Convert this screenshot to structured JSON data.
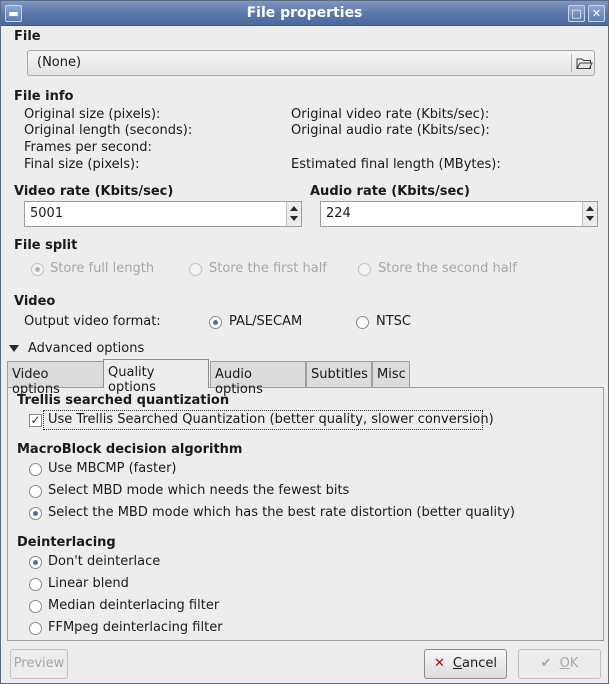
{
  "window": {
    "title": "File properties"
  },
  "file": {
    "section": "File",
    "selected": "(None)",
    "browse_icon": "folder-open-icon"
  },
  "file_info": {
    "section": "File info",
    "original_size": "Original size (pixels):",
    "original_length": "Original length (seconds):",
    "frames_per_second": "Frames per second:",
    "final_size": "Final size (pixels):",
    "original_video_rate": "Original video rate (Kbits/sec):",
    "original_audio_rate": "Original audio rate (Kbits/sec):",
    "estimated_final_length": "Estimated final length (MBytes):"
  },
  "video_rate": {
    "label": "Video rate (Kbits/sec)",
    "value": "5001"
  },
  "audio_rate": {
    "label": "Audio rate (Kbits/sec)",
    "value": "224"
  },
  "file_split": {
    "section": "File split",
    "options": [
      "Store full length",
      "Store the first half",
      "Store the second half"
    ],
    "selected": 0,
    "enabled": false
  },
  "video": {
    "section": "Video",
    "format_label": "Output video format:",
    "options": [
      "PAL/SECAM",
      "NTSC"
    ],
    "selected": 0
  },
  "advanced": {
    "label": "Advanced options",
    "expanded": true
  },
  "tabs": {
    "items": [
      "Video options",
      "Quality options",
      "Audio options",
      "Subtitles",
      "Misc"
    ],
    "active": 1
  },
  "quality": {
    "trellis_title": "Trellis searched quantization",
    "trellis_check": "Use Trellis Searched Quantization (better quality, slower conversion)",
    "trellis_checked": true,
    "macroblock_title": "MacroBlock decision algorithm",
    "macroblock_options": [
      "Use MBCMP (faster)",
      "Select MBD mode which needs the fewest bits",
      "Select the MBD mode which has the best rate distortion (better quality)"
    ],
    "macroblock_selected": 2,
    "deinterlacing_title": "Deinterlacing",
    "deinterlacing_options": [
      "Don't deinterlace",
      "Linear blend",
      "Median deinterlacing filter",
      "FFMpeg deinterlacing filter"
    ],
    "deinterlacing_selected": 0
  },
  "buttons": {
    "preview": "Preview",
    "cancel_underlined": "C",
    "cancel_rest": "ancel",
    "ok_underlined": "O",
    "ok_rest": "K"
  },
  "colors": {
    "titlebar": "#5d79ab",
    "window_bg": "#ededed",
    "radio_dot": "#4f6fa6",
    "cancel_icon": "#cc0000"
  }
}
